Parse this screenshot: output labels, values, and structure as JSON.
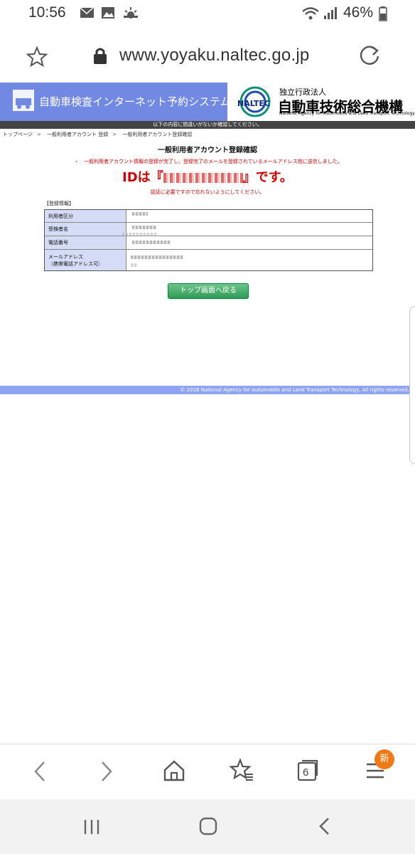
{
  "status_bar": {
    "time": "10:56",
    "battery": "46%"
  },
  "browser": {
    "url": "www.yoyaku.naltec.go.jp"
  },
  "header": {
    "system_title": "自動車検査インターネット予約システム",
    "org_prefix": "独立行政法人",
    "org_name": "自動車技術総合機構",
    "org_english": "National Agency for Automobile and Land Transport Technology",
    "logo_text": "NALTEC",
    "notice": "以下の内容に間違いがないか確認してください。"
  },
  "breadcrumb": {
    "items": [
      "トップページ",
      "一般利用者アカウント 登録",
      "一般利用者アカウント登録確認"
    ],
    "separator": ">"
  },
  "main": {
    "title": "一般利用者アカウント登録確認",
    "message": "・　一般利用者アカウント情報の登録が完了し、登録完了のメールを登録されているメールアドレス宛に送信しました。",
    "id_prefix": "IDは『",
    "id_suffix": "』です。",
    "warning": "認証に必要ですので忘れないようにしてください。",
    "section_label": "【登録情報】",
    "rows": [
      {
        "label": "利用者区分"
      },
      {
        "label": "受検者名"
      },
      {
        "label": "電話番号"
      },
      {
        "label": "メールアドレス",
        "sub": "（携帯電話アドレス可）"
      }
    ],
    "top_button": "トップ画面へ戻る"
  },
  "footer": {
    "copyright": "© 2016 National Agency for Automobile and Land Transport Technology, All rights reserved."
  },
  "bottom_bar": {
    "tab_count": "6",
    "badge": "新"
  },
  "colors": {
    "header_blue": "#7189e3",
    "accent_red": "#d10000",
    "button_green": "#2f9a55",
    "badge_orange": "#f07a15"
  }
}
